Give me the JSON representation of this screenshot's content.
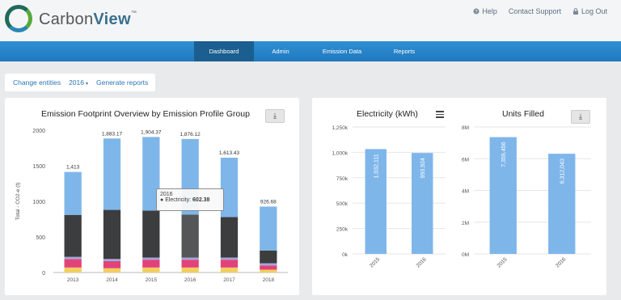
{
  "header": {
    "logo_text_light": "Carbon",
    "logo_text_bold": "View",
    "logo_tm": "™",
    "links": {
      "help": "Help",
      "contact": "Contact Support",
      "logout": "Log Out"
    }
  },
  "nav": {
    "items": [
      "Dashboard",
      "Admin",
      "Emission Data",
      "Reports"
    ],
    "active": "Dashboard"
  },
  "toolbar": {
    "change_entities": "Change entities",
    "year": "2016",
    "year_caret": "▾",
    "generate": "Generate reports"
  },
  "colors": {
    "nav_bg": "#2782c8",
    "nav_active": "#1a5f8f",
    "bar_blue": "#7fb6ea",
    "bar_dark": "#3c3d3f",
    "bar_pink": "#e2427a",
    "bar_yellow": "#f1cf5e"
  },
  "chart_data": [
    {
      "type": "bar",
      "stacked": true,
      "title": "Emission Footprint Overview by Emission Profile Group",
      "ylabel": "Total - CO2-e (t)",
      "categories": [
        "2013",
        "2014",
        "2015",
        "2016",
        "2017",
        "2018"
      ],
      "ylim": [
        0,
        2000
      ],
      "yticks": [
        "0",
        "500",
        "1000",
        "1500",
        "2000"
      ],
      "totals": [
        1413,
        1883.17,
        1904.37,
        1876.12,
        1613.43,
        926.68
      ],
      "total_labels": [
        "1,413",
        "1,883.17",
        "1,904.37",
        "1,876.12",
        "1,613.43",
        "926.68"
      ],
      "series": [
        {
          "name": "",
          "color": "#f1cf5e",
          "values": [
            70,
            60,
            70,
            70,
            70,
            40
          ]
        },
        {
          "name": "",
          "color": "#e2427a",
          "values": [
            120,
            100,
            110,
            110,
            110,
            60
          ]
        },
        {
          "name": "",
          "color": "#a0a8d8",
          "values": [
            30,
            30,
            30,
            30,
            30,
            30
          ]
        },
        {
          "name": "",
          "color": "#3c3d3f",
          "values": [
            590,
            690,
            660,
            602.38,
            570,
            180
          ]
        },
        {
          "name": "Electricity",
          "color": "#7fb6ea",
          "values": [
            603,
            1003.17,
            1034.37,
            1063.74,
            833.43,
            616.68
          ]
        }
      ],
      "tooltip": {
        "year": "2016",
        "series": "Electricity",
        "value": "602.38"
      },
      "grid": false
    },
    {
      "type": "bar",
      "title": "Electricity (kWh)",
      "categories": [
        "2015",
        "2016"
      ],
      "values": [
        1032111,
        993924
      ],
      "value_labels": [
        "1,032,111",
        "993,924"
      ],
      "ylim": [
        0,
        1250000
      ],
      "yticks": [
        "0k",
        "250k",
        "500k",
        "750k",
        "1,000k",
        "1,250k"
      ],
      "grid": true
    },
    {
      "type": "bar",
      "title": "Units Filled",
      "categories": [
        "2015",
        "2016"
      ],
      "values": [
        7359456,
        6312043
      ],
      "value_labels": [
        "7,359,456",
        "6,312,043"
      ],
      "ylim": [
        0,
        8000000
      ],
      "yticks": [
        "0M",
        "2M",
        "4M",
        "6M",
        "8M"
      ],
      "grid": true
    }
  ]
}
